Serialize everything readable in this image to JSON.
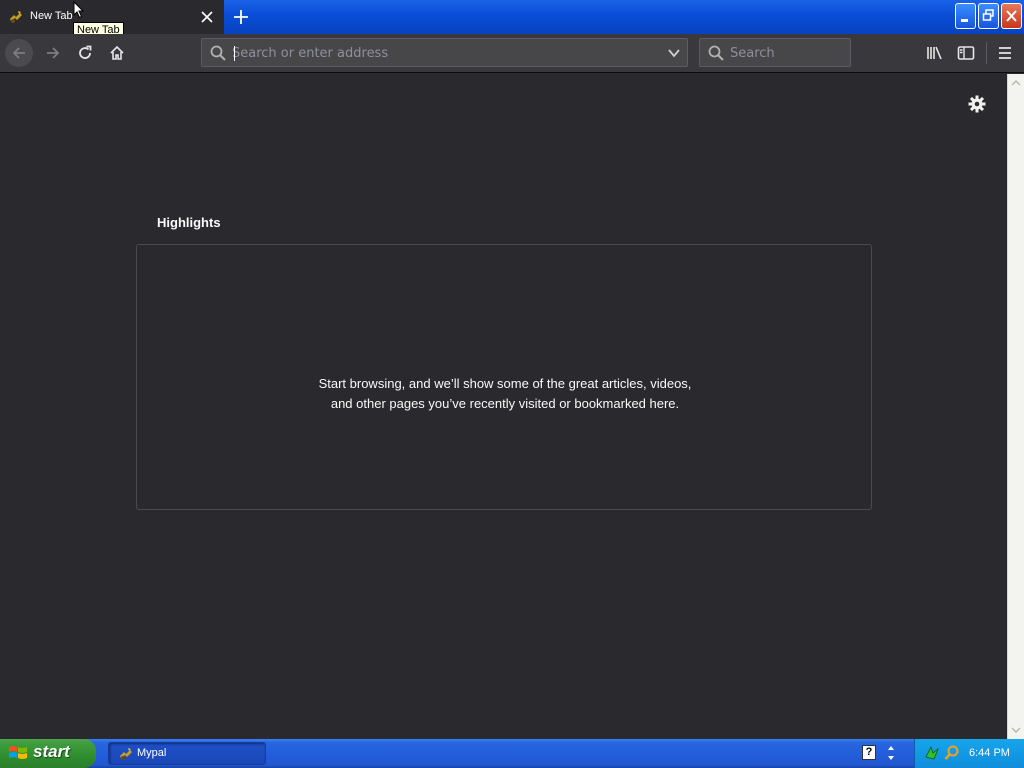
{
  "browser": {
    "tab": {
      "title": "New Tab",
      "tooltip": "New Tab"
    },
    "urlbar": {
      "placeholder": "Search or enter address",
      "value": ""
    },
    "searchbar": {
      "placeholder": "Search",
      "value": ""
    }
  },
  "content": {
    "section_title": "Highlights",
    "empty_message": "Start browsing, and we’ll show some of the great articles, videos, and other pages you’ve recently visited or bookmarked here."
  },
  "taskbar": {
    "start_label": "start",
    "task_label": "Mypal",
    "clock": "6:44 PM"
  },
  "colors": {
    "content_bg": "#2a2a2e",
    "toolbar_bg": "#38383d",
    "xp_blue": "#245edb",
    "start_green": "#3c9b3c"
  },
  "icons": [
    "mypal-favicon",
    "close-icon",
    "plus-icon",
    "arrow-back-icon",
    "arrow-forward-icon",
    "reload-icon",
    "home-icon",
    "search-icon",
    "chevron-down-icon",
    "library-icon",
    "sidebar-icon",
    "hamburger-menu-icon",
    "gear-icon",
    "windows-flag-icon",
    "help-icon"
  ]
}
